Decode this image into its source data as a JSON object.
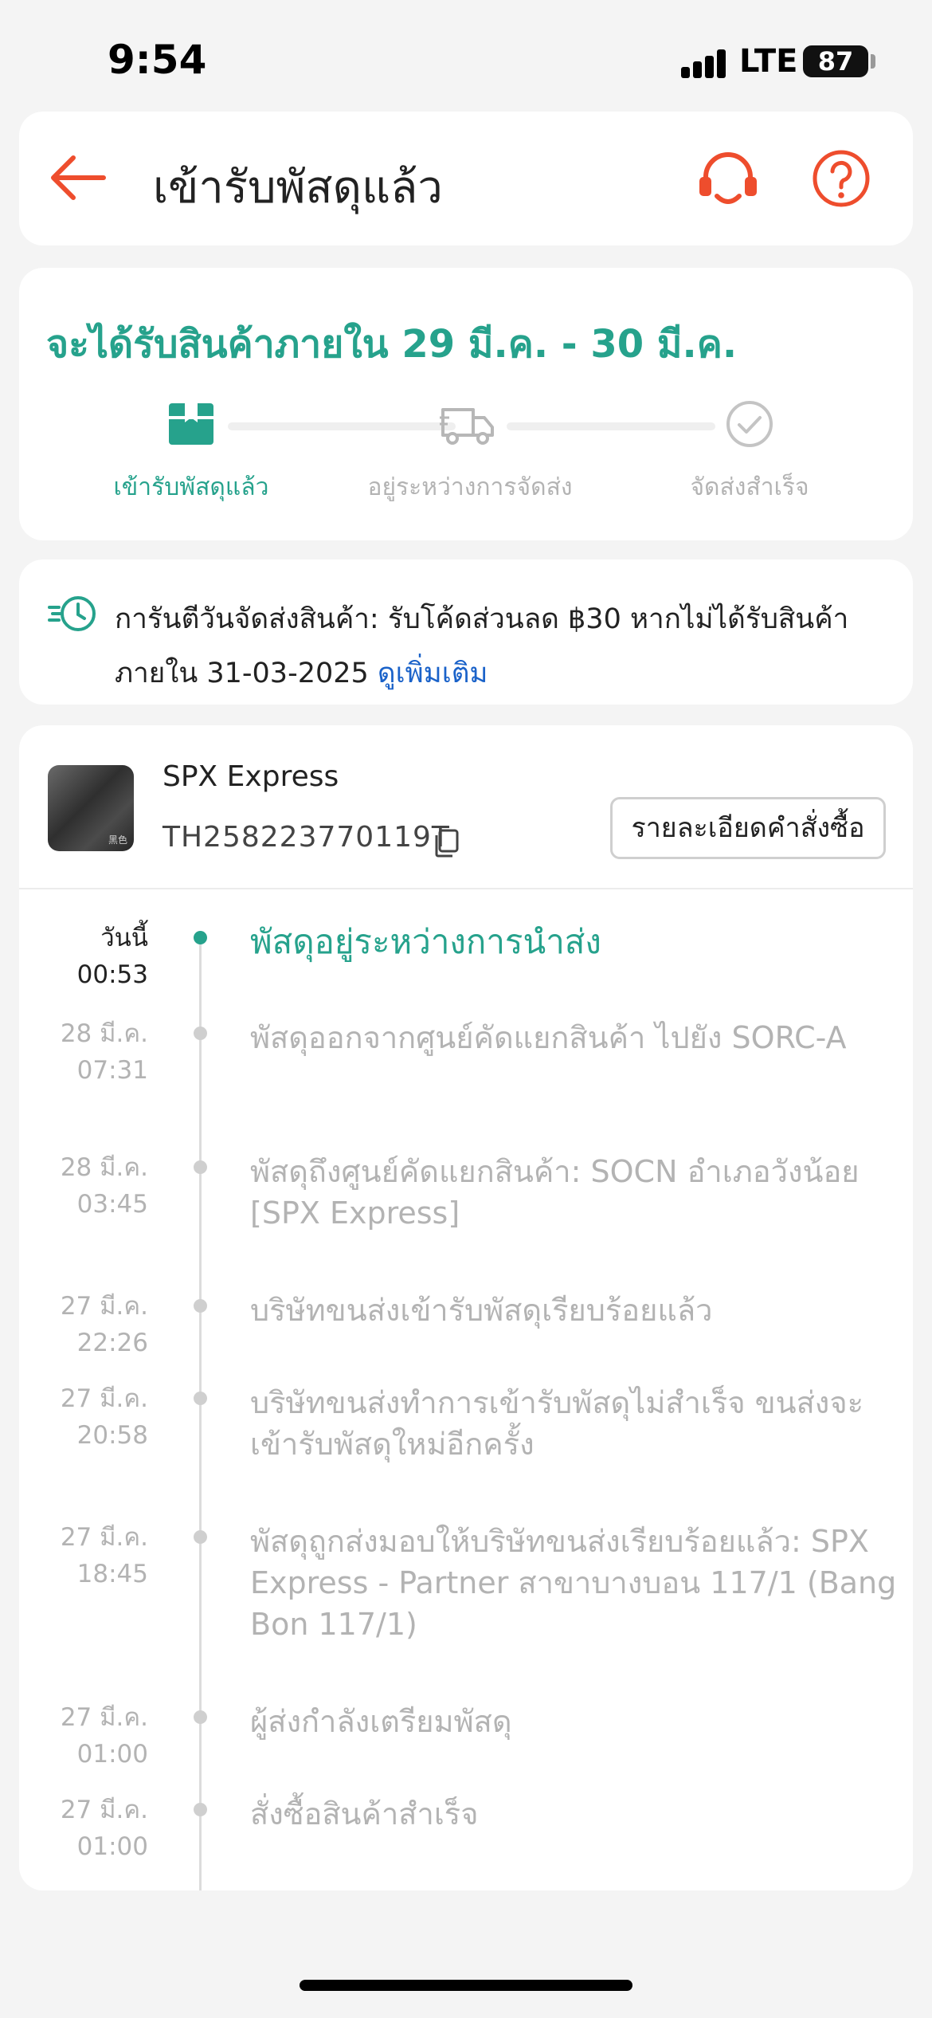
{
  "status_bar": {
    "time": "9:54",
    "network": "LTE",
    "battery": "87"
  },
  "header": {
    "title": "เข้ารับพัสดุแล้ว",
    "icons": [
      "back-arrow-icon",
      "headset-icon",
      "help-icon"
    ]
  },
  "delivery": {
    "eta": "จะได้รับสินค้าภายใน 29 มี.ค. - 30 มี.ค.",
    "steps": [
      {
        "label": "เข้ารับพัสดุแล้ว",
        "icon": "package-icon",
        "state": "active"
      },
      {
        "label": "อยู่ระหว่างการจัดส่ง",
        "icon": "truck-icon",
        "state": "inactive"
      },
      {
        "label": "จัดส่งสำเร็จ",
        "icon": "check-circle-icon",
        "state": "inactive"
      }
    ]
  },
  "guarantee": {
    "line1": "การันตีวันจัดส่งสินค้า: รับโค้ดส่วนลด ฿30 หากไม่ได้รับสินค้า",
    "line2": "ภายใน 31-03-2025 ",
    "link": "ดูเพิ่มเติม"
  },
  "shipment": {
    "carrier": "SPX Express",
    "tracking_number": "TH258223770119T",
    "order_details_label": "รายละเอียดคำสั่งซื้อ",
    "thumb_mark": "黑色"
  },
  "timeline": [
    {
      "date": "วันนี้",
      "time": "00:53",
      "desc": "พัสดุอยู่ระหว่างการนำส่ง"
    },
    {
      "date": "28 มี.ค.",
      "time": "07:31",
      "desc": "พัสดุออกจากศูนย์คัดแยกสินค้า ไปยัง SORC-A"
    },
    {
      "date": "28 มี.ค.",
      "time": "03:45",
      "desc": "พัสดุถึงศูนย์คัดแยกสินค้า: SOCN อำเภอวังน้อย [SPX Express]"
    },
    {
      "date": "27 มี.ค.",
      "time": "22:26",
      "desc": "บริษัทขนส่งเข้ารับพัสดุเรียบร้อยแล้ว"
    },
    {
      "date": "27 มี.ค.",
      "time": "20:58",
      "desc": "บริษัทขนส่งทำการเข้ารับพัสดุไม่สำเร็จ ขนส่งจะเข้ารับพัสดุใหม่อีกครั้ง"
    },
    {
      "date": "27 มี.ค.",
      "time": "18:45",
      "desc": "พัสดุถูกส่งมอบให้บริษัทขนส่งเรียบร้อยแล้ว: SPX Express - Partner สาขาบางบอน 117/1 (Bang Bon 117/1)"
    },
    {
      "date": "27 มี.ค.",
      "time": "01:00",
      "desc": " ผู้ส่งกำลังเตรียมพัสดุ"
    },
    {
      "date": "27 มี.ค.",
      "time": "01:00",
      "desc": "สั่งซื้อสินค้าสำเร็จ"
    }
  ],
  "colors": {
    "accent": "#26a28c",
    "brand": "#ee4d2d",
    "link": "#1a62c9",
    "muted": "#b3b3b3"
  }
}
